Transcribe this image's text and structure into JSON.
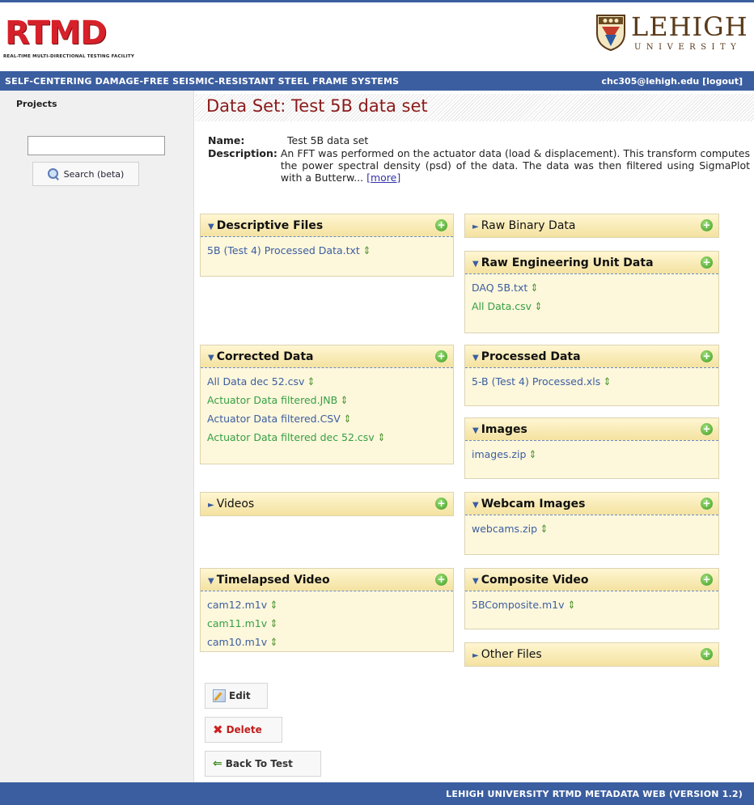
{
  "header": {
    "logo_text": "RTMD",
    "logo_subtitle": "REAL-TIME MULTI-DIRECTIONAL TESTING FACILITY",
    "university_name": "LEHIGH",
    "university_sub": "UNIVERSITY"
  },
  "navbar": {
    "project_title": "SELF-CENTERING DAMAGE-FREE SEISMIC-RESISTANT STEEL FRAME SYSTEMS",
    "user_email": "chc305@lehigh.edu",
    "logout_label": "[logout]"
  },
  "sidebar": {
    "projects_label": "Projects",
    "search_value": "",
    "search_button": "Search (beta)"
  },
  "main": {
    "title": "Data Set: Test 5B data set",
    "name_label": "Name:",
    "name_value": "Test 5B data set",
    "description_label": "Description:",
    "description_text": "An FFT was performed on the actuator data (load & displacement). This transform computes the power spectral density (psd) of the data. The data was then filtered using SigmaPlot with a Butterw...",
    "more_label": "[more]"
  },
  "panels": {
    "descriptive_files": {
      "title": "Descriptive Files",
      "files": [
        "5B (Test 4) Processed Data.txt"
      ]
    },
    "raw_binary": {
      "title": "Raw Binary Data"
    },
    "raw_engineering": {
      "title": "Raw Engineering Unit Data",
      "files": [
        "DAQ 5B.txt",
        "All Data.csv"
      ]
    },
    "corrected": {
      "title": "Corrected Data",
      "files": [
        "All Data dec 52.csv",
        "Actuator Data filtered.JNB",
        "Actuator Data filtered.CSV",
        "Actuator Data filtered dec 52.csv"
      ]
    },
    "processed": {
      "title": "Processed Data",
      "files": [
        "5-B (Test 4) Processed.xls"
      ]
    },
    "images": {
      "title": "Images",
      "files": [
        "images.zip"
      ]
    },
    "videos": {
      "title": "Videos"
    },
    "webcam": {
      "title": "Webcam Images",
      "files": [
        "webcams.zip"
      ]
    },
    "timelapsed": {
      "title": "Timelapsed Video",
      "files": [
        "cam12.m1v",
        "cam11.m1v",
        "cam10.m1v"
      ]
    },
    "composite": {
      "title": "Composite Video",
      "files": [
        "5BComposite.m1v"
      ]
    },
    "other": {
      "title": "Other Files"
    }
  },
  "actions": {
    "edit": "Edit",
    "delete": "Delete",
    "back": "Back To Test"
  },
  "footer": {
    "text": "LEHIGH UNIVERSITY RTMD METADATA WEB (VERSION 1.2)"
  },
  "colors": {
    "brand_blue": "#3b5ea0",
    "title_red": "#8b1a1a",
    "panel_bg": "#fdf7dc",
    "link_blue": "#3b5ea0",
    "link_green": "#35a043"
  }
}
